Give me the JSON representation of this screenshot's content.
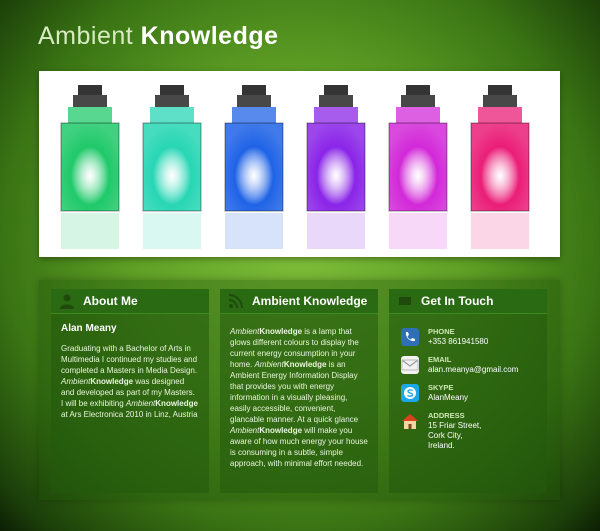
{
  "header": {
    "title_light": "Ambient",
    "title_bold": "Knowledge"
  },
  "banner": {
    "lamp_colors": [
      "#1fc96a",
      "#27d6b4",
      "#1f63e6",
      "#8a25e8",
      "#d229d8",
      "#ea1e77"
    ]
  },
  "about": {
    "heading": "About Me",
    "name": "Alan Meany",
    "paragraph_1": "Graduating with a Bachelor of Arts in Multimedia I continued my studies and completed a Masters in Media Design.",
    "brand_ambient": "Ambient",
    "brand_knowledge": "Knowledge",
    "paragraph_2": " was designed and developed as part of my Masters. I will be exhibiting ",
    "paragraph_3": " at Ars Electronica 2010 in Linz, Austria"
  },
  "ambient": {
    "heading": "Ambient Knowledge",
    "brand_ambient": "Ambient",
    "brand_knowledge": "Knowledge",
    "text_1": " is a lamp that glows different colours to display the current energy consumption in your home. ",
    "text_2": " is an Ambient Energy Information Display that provides you with energy information in a visually pleasing, easily accessible, convenient, glancable manner. At a quick glance ",
    "text_3": " will make you aware of how much energy your house is consuming in a subtle, simple approach, with minimal effort needed."
  },
  "contact": {
    "heading": "Get In Touch",
    "items": [
      {
        "label": "PHONE",
        "lines": [
          "+353 861941580"
        ],
        "icon": "phone-icon"
      },
      {
        "label": "EMAIL",
        "lines": [
          "alan.meanya@gmail.com"
        ],
        "icon": "email-icon"
      },
      {
        "label": "SKYPE",
        "lines": [
          "AlanMeany"
        ],
        "icon": "skype-icon"
      },
      {
        "label": "Address",
        "lines": [
          "15 Friar Street,",
          "Cork City,",
          "Ireland."
        ],
        "icon": "home-icon"
      }
    ]
  }
}
